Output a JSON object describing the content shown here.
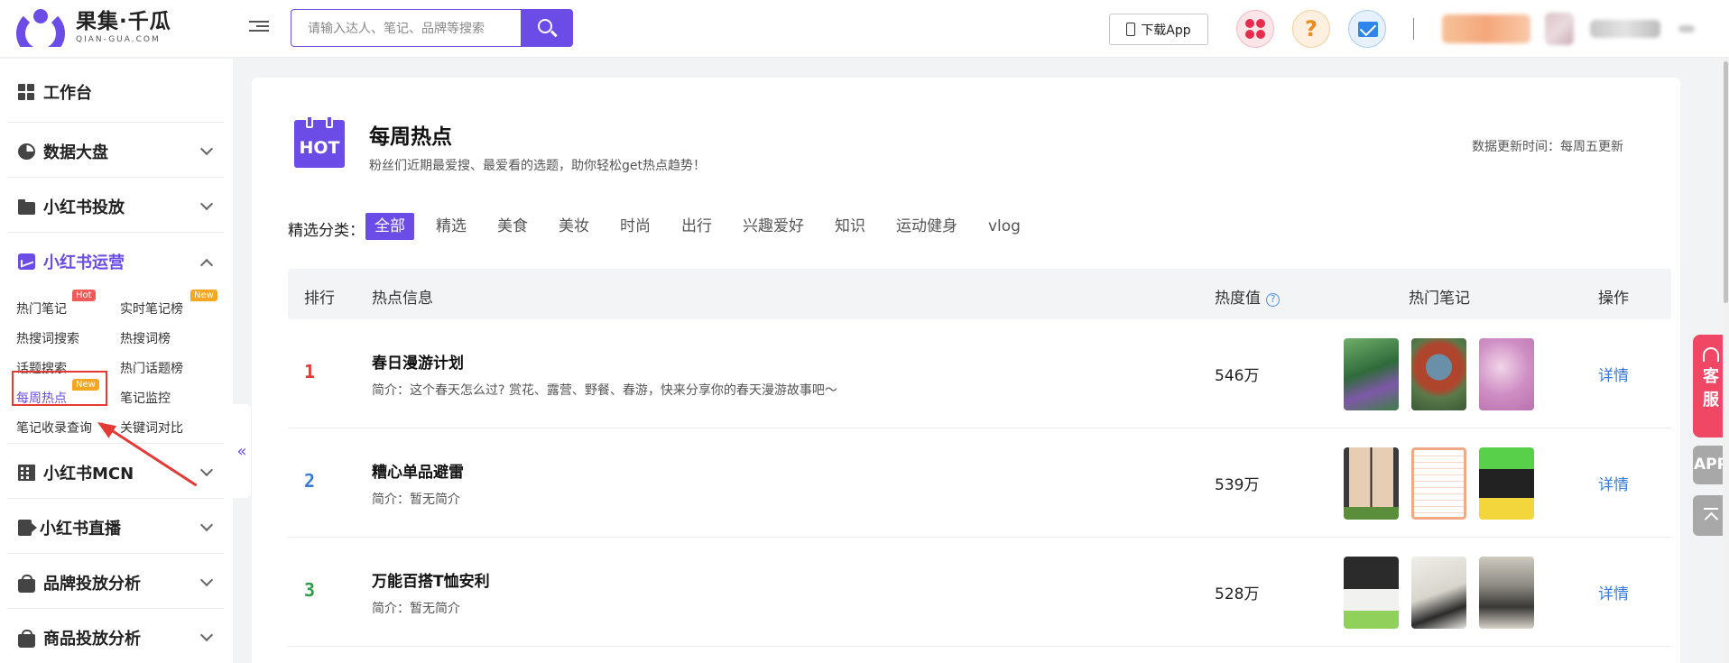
{
  "header": {
    "logo_cn": "果集·千瓜",
    "logo_en": "QIAN-GUA.COM",
    "search_placeholder": "请输入达人、笔记、品牌等搜索",
    "download_label": "下载App",
    "help_symbol": "?"
  },
  "sidebar": {
    "workbench": "工作台",
    "groups": [
      {
        "label": "数据大盘"
      },
      {
        "label": "小红书投放"
      },
      {
        "label": "小红书运营"
      },
      {
        "label": "小红书MCN"
      },
      {
        "label": "小红书直播"
      },
      {
        "label": "品牌投放分析"
      },
      {
        "label": "商品投放分析"
      }
    ],
    "sub_items": [
      {
        "label": "热门笔记",
        "badge": "Hot"
      },
      {
        "label": "实时笔记榜",
        "badge": "New"
      },
      {
        "label": "热搜词搜索"
      },
      {
        "label": "热搜词榜"
      },
      {
        "label": "话题搜索"
      },
      {
        "label": "热门话题榜"
      },
      {
        "label": "每周热点",
        "badge": "New"
      },
      {
        "label": "笔记监控"
      },
      {
        "label": "笔记收录查询"
      },
      {
        "label": "关键词对比"
      }
    ],
    "collapse_symbol": "«"
  },
  "main": {
    "logo_text": "HOT",
    "title": "每周热点",
    "subtitle": "粉丝们近期最爱搜、最爱看的选题，助你轻松get热点趋势！",
    "update_time": "数据更新时间：每周五更新",
    "filter_label": "精选分类：",
    "filters": [
      "全部",
      "精选",
      "美食",
      "美妆",
      "时尚",
      "出行",
      "兴趣爱好",
      "知识",
      "运动健身",
      "vlog"
    ],
    "columns": {
      "rank": "排行",
      "info": "热点信息",
      "heat": "热度值",
      "notes": "热门笔记",
      "action": "操作"
    },
    "info_symbol": "?",
    "rows": [
      {
        "rank": "1",
        "title": "春日漫游计划",
        "intro": "简介：这个春天怎么过? 赏花、露营、野餐、春游，快来分享你的春天漫游故事吧～",
        "heat": "546万",
        "action": "详情",
        "rank_color": "#e53935"
      },
      {
        "rank": "2",
        "title": "糟心单品避雷",
        "intro": "简介：暂无简介",
        "heat": "539万",
        "action": "详情",
        "rank_color": "#3a7bd5"
      },
      {
        "rank": "3",
        "title": "万能百搭T恤安利",
        "intro": "简介：暂无简介",
        "heat": "528万",
        "action": "详情",
        "rank_color": "#2e9e48"
      }
    ]
  },
  "floating": {
    "service_1": "客",
    "service_2": "服",
    "app": "APP"
  },
  "colors": {
    "accent": "#6b4ce6",
    "service": "#f04864"
  }
}
